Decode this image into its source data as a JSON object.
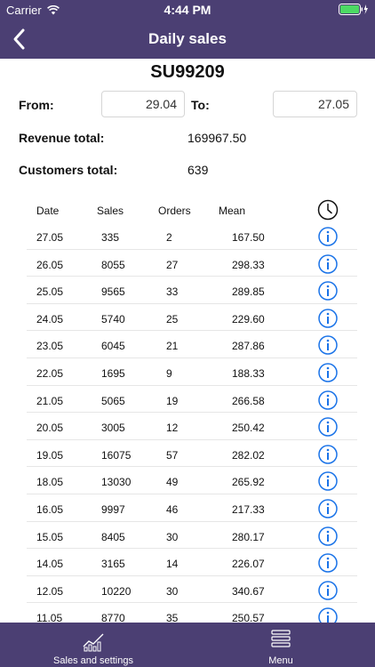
{
  "status": {
    "carrier": "Carrier",
    "time": "4:44 PM"
  },
  "nav": {
    "title": "Daily sales"
  },
  "store_code": "SU99209",
  "filter": {
    "from_label": "From:",
    "from_value": "29.04",
    "to_label": "To:",
    "to_value": "27.05"
  },
  "summary": {
    "revenue_label": "Revenue total:",
    "revenue_value": "169967.50",
    "customers_label": "Customers total:",
    "customers_value": "639"
  },
  "table": {
    "headers": {
      "date": "Date",
      "sales": "Sales",
      "orders": "Orders",
      "mean": "Mean"
    },
    "rows": [
      {
        "date": "27.05",
        "sales": "335",
        "orders": "2",
        "mean": "167.50"
      },
      {
        "date": "26.05",
        "sales": "8055",
        "orders": "27",
        "mean": "298.33"
      },
      {
        "date": "25.05",
        "sales": "9565",
        "orders": "33",
        "mean": "289.85"
      },
      {
        "date": "24.05",
        "sales": "5740",
        "orders": "25",
        "mean": "229.60"
      },
      {
        "date": "23.05",
        "sales": "6045",
        "orders": "21",
        "mean": "287.86"
      },
      {
        "date": "22.05",
        "sales": "1695",
        "orders": "9",
        "mean": "188.33"
      },
      {
        "date": "21.05",
        "sales": "5065",
        "orders": "19",
        "mean": "266.58"
      },
      {
        "date": "20.05",
        "sales": "3005",
        "orders": "12",
        "mean": "250.42"
      },
      {
        "date": "19.05",
        "sales": "16075",
        "orders": "57",
        "mean": "282.02"
      },
      {
        "date": "18.05",
        "sales": "13030",
        "orders": "49",
        "mean": "265.92"
      },
      {
        "date": "16.05",
        "sales": "9997",
        "orders": "46",
        "mean": "217.33"
      },
      {
        "date": "15.05",
        "sales": "8405",
        "orders": "30",
        "mean": "280.17"
      },
      {
        "date": "14.05",
        "sales": "3165",
        "orders": "14",
        "mean": "226.07"
      },
      {
        "date": "12.05",
        "sales": "10220",
        "orders": "30",
        "mean": "340.67"
      },
      {
        "date": "11.05",
        "sales": "8770",
        "orders": "35",
        "mean": "250.57"
      }
    ]
  },
  "tabs": {
    "sales_label": "Sales and settings",
    "menu_label": "Menu"
  },
  "colors": {
    "bar": "#4b3f73",
    "info_blue": "#1a73e8"
  }
}
